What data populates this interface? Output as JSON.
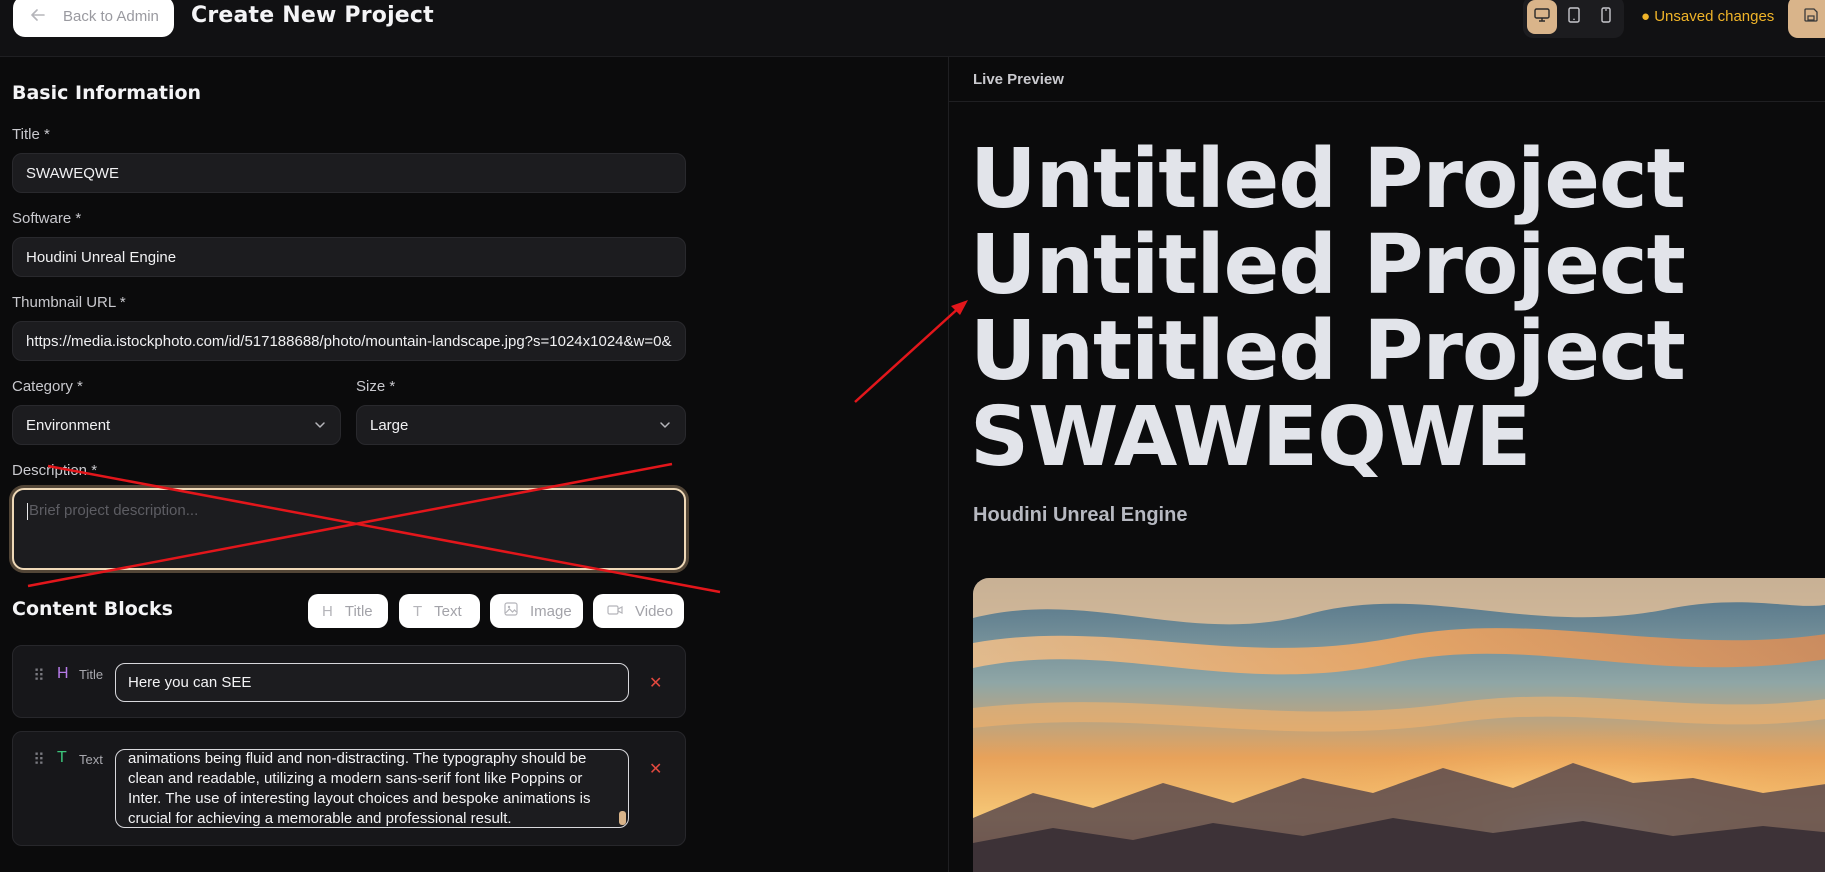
{
  "topbar": {
    "back_label": "Back to Admin",
    "page_title": "Create New Project",
    "unsaved_text": "● Unsaved changes",
    "device_modes": [
      "desktop",
      "tablet",
      "mobile"
    ],
    "active_device": "desktop"
  },
  "basic_info": {
    "heading": "Basic Information",
    "title_label": "Title *",
    "title_value": "SWAWEQWE",
    "software_label": "Software *",
    "software_value": "Houdini Unreal Engine",
    "thumbnail_label": "Thumbnail URL *",
    "thumbnail_value": "https://media.istockphoto.com/id/517188688/photo/mountain-landscape.jpg?s=1024x1024&w=0&",
    "category_label": "Category *",
    "category_value": "Environment",
    "size_label": "Size *",
    "size_value": "Large",
    "description_label": "Description *",
    "description_placeholder": "Brief project description..."
  },
  "content_blocks": {
    "heading": "Content Blocks",
    "add_buttons": [
      "Title",
      "Text",
      "Image",
      "Video"
    ],
    "blocks": [
      {
        "type_label": "Title",
        "value": "Here you can SEE"
      },
      {
        "type_label": "Text",
        "value": "animations being fluid and non-distracting. The typography should be clean and readable, utilizing a modern sans-serif font like Poppins or Inter. The use of interesting layout choices and bespoke animations is crucial for achieving a memorable and professional result."
      }
    ]
  },
  "preview": {
    "label": "Live Preview",
    "hero_lines": [
      "Untitled Project",
      "Untitled Project",
      "Untitled Project",
      "SWAWEQWE"
    ],
    "subtitle": "Houdini Unreal Engine"
  },
  "colors": {
    "accent": "#d9b48a",
    "warning": "#f0b429",
    "danger": "#e0483e",
    "annotation": "#e3161b",
    "title_block_icon": "#b67be8",
    "text_block_icon": "#3cc47a"
  }
}
